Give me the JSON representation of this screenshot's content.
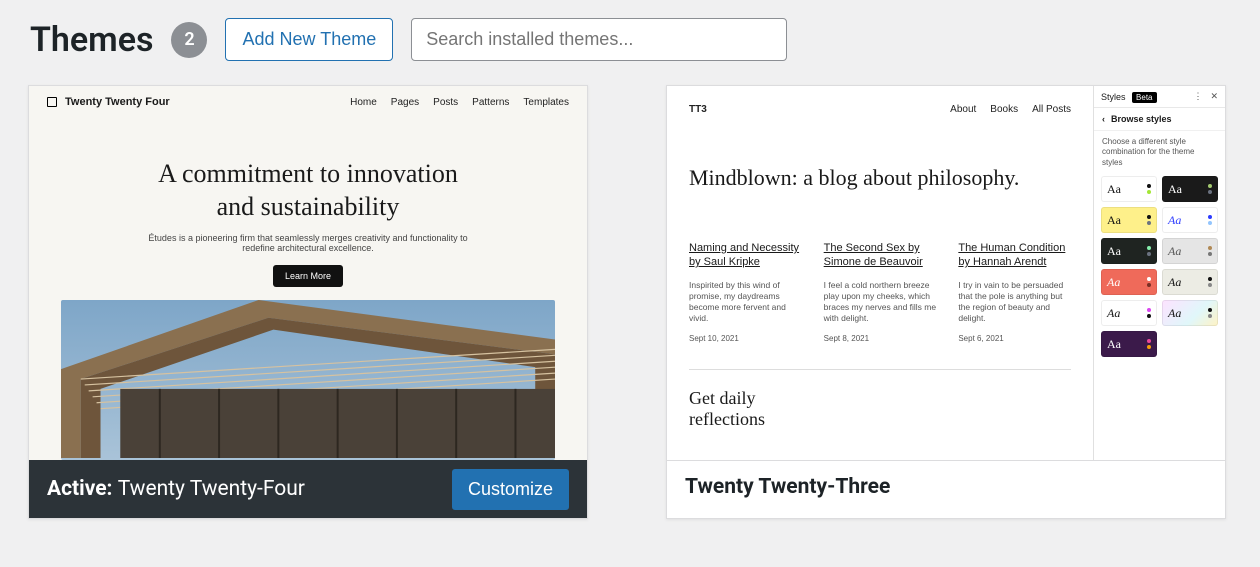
{
  "header": {
    "title": "Themes",
    "count": "2",
    "add_button": "Add New Theme",
    "search_placeholder": "Search installed themes..."
  },
  "themes": [
    {
      "active_prefix": "Active:",
      "name": "Twenty Twenty-Four",
      "customize_label": "Customize"
    },
    {
      "name": "Twenty Twenty-Three"
    }
  ],
  "preview24": {
    "site_title": "Twenty Twenty Four",
    "nav": [
      "Home",
      "Pages",
      "Posts",
      "Patterns",
      "Templates"
    ],
    "hero_line1": "A commitment to innovation",
    "hero_line2": "and sustainability",
    "hero_sub": "Études is a pioneering firm that seamlessly merges creativity and functionality to redefine architectural excellence.",
    "cta": "Learn More"
  },
  "preview23": {
    "site_title": "TT3",
    "nav": [
      "About",
      "Books",
      "All Posts"
    ],
    "headline": "Mindblown: a blog about philosophy.",
    "posts": [
      {
        "title": "Naming and Necessity by Saul Kripke",
        "excerpt": "Inspirited by this wind of promise, my daydreams become more fervent and vivid.",
        "date": "Sept 10, 2021"
      },
      {
        "title": "The Second Sex by Simone de Beauvoir",
        "excerpt": "I feel a cold northern breeze play upon my cheeks, which braces my nerves and fills me with delight.",
        "date": "Sept 8, 2021"
      },
      {
        "title": "The Human Condition by Hannah Arendt",
        "excerpt": "I try in vain to be persuaded that the pole is anything but the region of beauty and delight.",
        "date": "Sept 6, 2021"
      }
    ],
    "cta_line1": "Get daily",
    "cta_line2": "reflections",
    "styles": {
      "panel_title": "Styles",
      "beta": "Beta",
      "browse": "Browse styles",
      "desc": "Choose a different style combination for the theme styles",
      "swatches": [
        {
          "bg": "#ffffff",
          "fg": "#111",
          "d1": "#111",
          "d2": "#a3e635",
          "italic": false
        },
        {
          "bg": "#1a1a1a",
          "fg": "#fff",
          "d1": "#a3c96f",
          "d2": "#6b7280",
          "italic": false
        },
        {
          "bg": "#fef08a",
          "fg": "#111",
          "d1": "#111",
          "d2": "#6b7280",
          "italic": false
        },
        {
          "bg": "#ffffff",
          "fg": "#2d3cff",
          "d1": "#2d3cff",
          "d2": "#93c5fd",
          "italic": true
        },
        {
          "bg": "#1f2421",
          "fg": "#fff",
          "d1": "#86efac",
          "d2": "#6b7280",
          "italic": false
        },
        {
          "bg": "#e5e5e5",
          "fg": "#555",
          "d1": "#b08955",
          "d2": "#777",
          "italic": true
        },
        {
          "bg": "#ef6a5a",
          "fg": "#fff",
          "d1": "#fff",
          "d2": "#7a2e25",
          "italic": true
        },
        {
          "bg": "#ecece4",
          "fg": "#111",
          "d1": "#111",
          "d2": "#888",
          "italic": true
        },
        {
          "bg": "#ffffff",
          "fg": "#111",
          "d1": "#d946ef",
          "d2": "#111",
          "italic": true
        },
        {
          "bg": "linear-gradient(135deg,#fde2ff 0%,#e0f7fa 60%,#fff3c4 100%)",
          "fg": "#111",
          "d1": "#111",
          "d2": "#888",
          "italic": true
        },
        {
          "bg": "#3b1a4a",
          "fg": "#fff",
          "d1": "#ec4899",
          "d2": "#f59e0b",
          "italic": false
        }
      ]
    }
  }
}
